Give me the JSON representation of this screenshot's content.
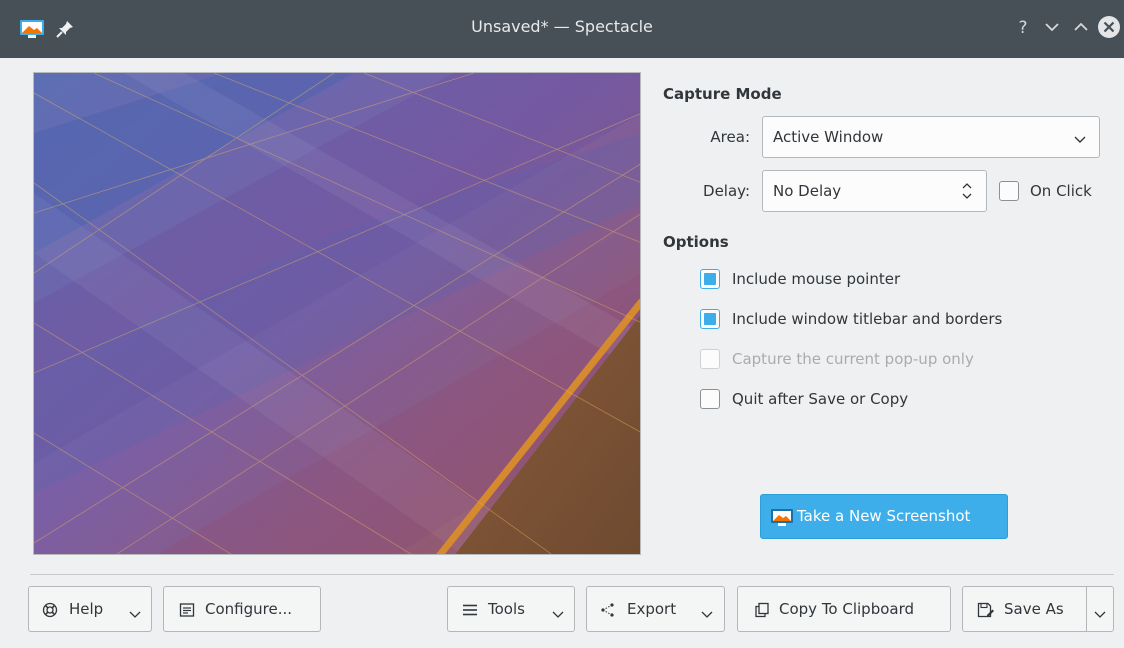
{
  "window": {
    "title": "Unsaved* — Spectacle",
    "help_glyph": "?"
  },
  "capture_mode": {
    "heading": "Capture Mode",
    "area_label": "Area:",
    "area_value": "Active Window",
    "delay_label": "Delay:",
    "delay_value": "No Delay",
    "on_click_label": "On Click",
    "on_click_checked": false
  },
  "options": {
    "heading": "Options",
    "items": [
      {
        "label": "Include mouse pointer",
        "checked": true,
        "enabled": true
      },
      {
        "label": "Include window titlebar and borders",
        "checked": true,
        "enabled": true
      },
      {
        "label": "Capture the current pop-up only",
        "checked": false,
        "enabled": false
      },
      {
        "label": "Quit after Save or Copy",
        "checked": false,
        "enabled": true
      }
    ]
  },
  "actions": {
    "take_screenshot": "Take a New Screenshot"
  },
  "footer": {
    "help": "Help",
    "configure": "Configure...",
    "tools": "Tools",
    "export": "Export",
    "copy": "Copy To Clipboard",
    "save_as": "Save As"
  },
  "colors": {
    "accent": "#3daee9",
    "titlebar": "#475057",
    "window_bg": "#eff0f1"
  }
}
